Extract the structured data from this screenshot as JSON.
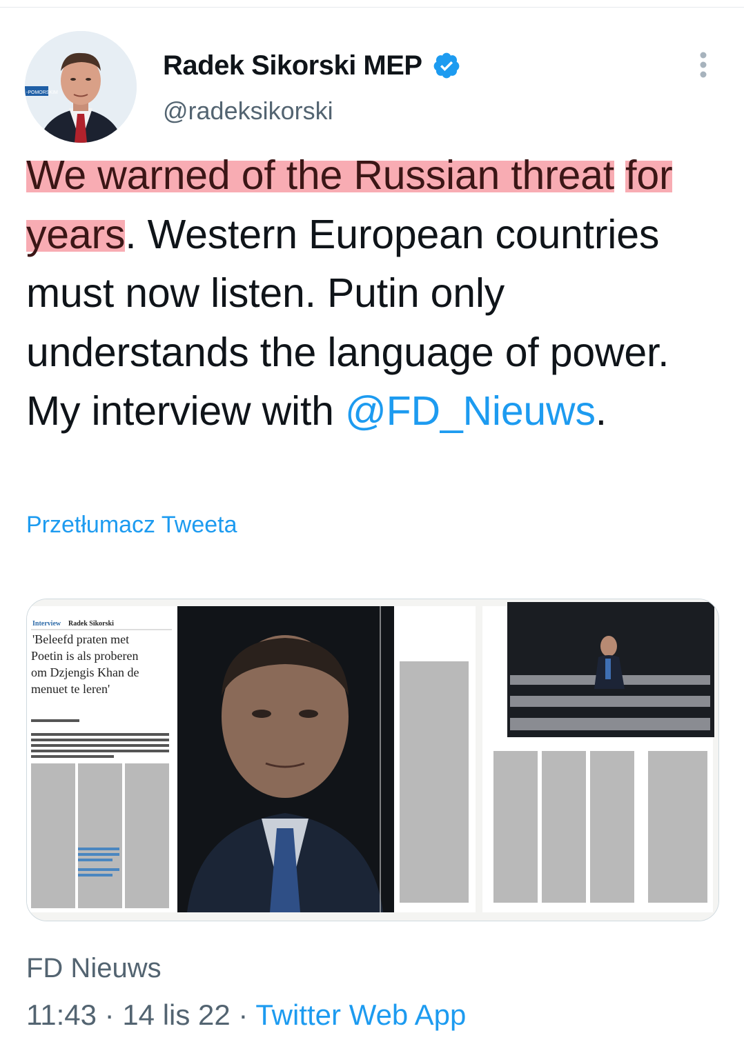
{
  "author": {
    "name": "Radek Sikorski MEP",
    "handle": "@radeksikorski",
    "verified": true,
    "avatar_logo": "-POMORSKIM"
  },
  "tweet": {
    "highlight_line1": "We warned of the Russian threat",
    "highlight_line2": "for years",
    "text_rest": ". Western European countries must now listen. Putin only understands the language of power. My interview with ",
    "mention": "@FD_Nieuws",
    "text_end": "."
  },
  "translate_label": "Przetłumacz Tweeta",
  "media": {
    "section": "Interview",
    "person": "Radek Sikorski",
    "headline_line1": "'Beleefd praten met",
    "headline_line2": "Poetin is als proberen",
    "headline_line3": "om Dzjengis Khan de",
    "headline_line4": "menuet te leren'"
  },
  "source_label": "FD Nieuws",
  "meta": {
    "time": "11:43",
    "separator1": " · ",
    "date": "14 lis 22",
    "separator2": " · ",
    "app": "Twitter Web App"
  },
  "colors": {
    "link": "#1d9bf0",
    "secondary": "#536471",
    "highlight": "#f68c96"
  },
  "icons": [
    "verified-badge-icon",
    "more-options-icon"
  ]
}
